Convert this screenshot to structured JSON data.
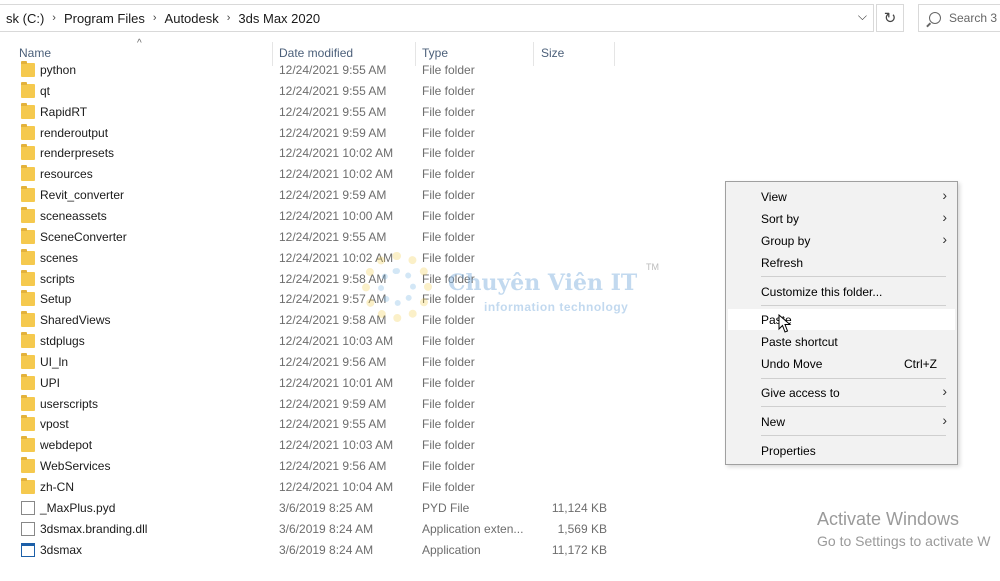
{
  "address": {
    "crumbs": [
      "sk (C:)",
      "Program Files",
      "Autodesk",
      "3ds Max 2020"
    ],
    "search_placeholder": "Search 3"
  },
  "columns": {
    "name": "Name",
    "date": "Date modified",
    "type": "Type",
    "size": "Size"
  },
  "rows": [
    {
      "name": "python",
      "date": "12/24/2021 9:55 AM",
      "type": "File folder",
      "size": "",
      "icon": "folder-icon"
    },
    {
      "name": "qt",
      "date": "12/24/2021 9:55 AM",
      "type": "File folder",
      "size": "",
      "icon": "folder-icon"
    },
    {
      "name": "RapidRT",
      "date": "12/24/2021 9:55 AM",
      "type": "File folder",
      "size": "",
      "icon": "folder-icon"
    },
    {
      "name": "renderoutput",
      "date": "12/24/2021 9:59 AM",
      "type": "File folder",
      "size": "",
      "icon": "folder-icon"
    },
    {
      "name": "renderpresets",
      "date": "12/24/2021 10:02 AM",
      "type": "File folder",
      "size": "",
      "icon": "folder-icon"
    },
    {
      "name": "resources",
      "date": "12/24/2021 10:02 AM",
      "type": "File folder",
      "size": "",
      "icon": "folder-icon"
    },
    {
      "name": "Revit_converter",
      "date": "12/24/2021 9:59 AM",
      "type": "File folder",
      "size": "",
      "icon": "folder-icon"
    },
    {
      "name": "sceneassets",
      "date": "12/24/2021 10:00 AM",
      "type": "File folder",
      "size": "",
      "icon": "folder-icon"
    },
    {
      "name": "SceneConverter",
      "date": "12/24/2021 9:55 AM",
      "type": "File folder",
      "size": "",
      "icon": "folder-icon"
    },
    {
      "name": "scenes",
      "date": "12/24/2021 10:02 AM",
      "type": "File folder",
      "size": "",
      "icon": "folder-icon"
    },
    {
      "name": "scripts",
      "date": "12/24/2021 9:58 AM",
      "type": "File folder",
      "size": "",
      "icon": "folder-icon"
    },
    {
      "name": "Setup",
      "date": "12/24/2021 9:57 AM",
      "type": "File folder",
      "size": "",
      "icon": "folder-icon"
    },
    {
      "name": "SharedViews",
      "date": "12/24/2021 9:58 AM",
      "type": "File folder",
      "size": "",
      "icon": "folder-icon"
    },
    {
      "name": "stdplugs",
      "date": "12/24/2021 10:03 AM",
      "type": "File folder",
      "size": "",
      "icon": "folder-icon"
    },
    {
      "name": "UI_ln",
      "date": "12/24/2021 9:56 AM",
      "type": "File folder",
      "size": "",
      "icon": "folder-icon"
    },
    {
      "name": "UPI",
      "date": "12/24/2021 10:01 AM",
      "type": "File folder",
      "size": "",
      "icon": "folder-icon"
    },
    {
      "name": "userscripts",
      "date": "12/24/2021 9:59 AM",
      "type": "File folder",
      "size": "",
      "icon": "folder-icon"
    },
    {
      "name": "vpost",
      "date": "12/24/2021 9:55 AM",
      "type": "File folder",
      "size": "",
      "icon": "folder-icon"
    },
    {
      "name": "webdepot",
      "date": "12/24/2021 10:03 AM",
      "type": "File folder",
      "size": "",
      "icon": "folder-icon"
    },
    {
      "name": "WebServices",
      "date": "12/24/2021 9:56 AM",
      "type": "File folder",
      "size": "",
      "icon": "folder-icon"
    },
    {
      "name": "zh-CN",
      "date": "12/24/2021 10:04 AM",
      "type": "File folder",
      "size": "",
      "icon": "folder-icon"
    },
    {
      "name": "_MaxPlus.pyd",
      "date": "3/6/2019 8:25 AM",
      "type": "PYD File",
      "size": "11,124 KB",
      "icon": "file-icon"
    },
    {
      "name": "3dsmax.branding.dll",
      "date": "3/6/2019 8:24 AM",
      "type": "Application exten...",
      "size": "1,569 KB",
      "icon": "file-icon"
    },
    {
      "name": "3dsmax",
      "date": "3/6/2019 8:24 AM",
      "type": "Application",
      "size": "11,172 KB",
      "icon": "app-icon"
    }
  ],
  "watermark": {
    "title": "Chuyên Viên IT",
    "tm": "TM",
    "subtitle": "information technology"
  },
  "context_menu": {
    "view": "View",
    "sort_by": "Sort by",
    "group_by": "Group by",
    "refresh": "Refresh",
    "customize": "Customize this folder...",
    "paste": "Paste",
    "paste_shortcut": "Paste shortcut",
    "undo_move": "Undo Move",
    "undo_shortcut": "Ctrl+Z",
    "give_access": "Give access to",
    "new": "New",
    "properties": "Properties"
  },
  "activation": {
    "title": "Activate Windows",
    "subtitle": "Go to Settings to activate W"
  }
}
